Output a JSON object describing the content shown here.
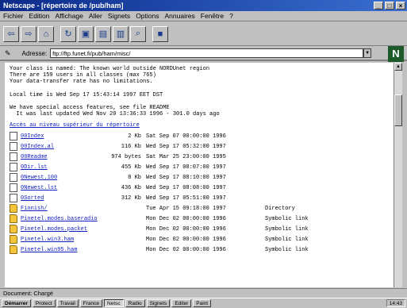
{
  "window": {
    "title": "Netscape - [répertoire de /pub/ham]"
  },
  "menu": [
    "Fichier",
    "Edition",
    "Affichage",
    "Aller",
    "Signets",
    "Options",
    "Annuaires",
    "Fenêtre",
    "?"
  ],
  "toolbar": {
    "buttons": [
      "back-icon",
      "forward-icon",
      "home-icon",
      "reload-icon",
      "images-icon",
      "open-icon",
      "print-icon",
      "find-icon",
      "stop-icon"
    ]
  },
  "address": {
    "label": "Adresse:",
    "url": "ftp://ftp.funet.fi/pub/ham/misc/"
  },
  "messages": [
    "Your class is named: The known world outside NORDUnet region",
    "There are 159 users in all classes (max 765)",
    "Your data-transfer rate has no limitations.",
    "",
    "Local time is Wed Sep 17 15:43:14 1997 EET DST",
    "",
    "We have special access features, see file README",
    "  It was last updated Wed Nov 20 13:36:33 1996 - 301.0 days ago"
  ],
  "parent_link": "Accès au niveau supérieur du répertoire",
  "files": [
    {
      "icon": "file",
      "name": "00Index",
      "size": "2 Kb",
      "date": "Sat Sep 07 00:00:00 1996",
      "type": ""
    },
    {
      "icon": "file",
      "name": "00Index.al",
      "size": "116 Kb",
      "date": "Wed Sep 17 05:32:00 1997",
      "type": ""
    },
    {
      "icon": "file",
      "name": "00Readme",
      "size": "974 bytes",
      "date": "Sat Mar 25 23:00:00 1995",
      "type": ""
    },
    {
      "icon": "file",
      "name": "0Dir.lst",
      "size": "455 Kb",
      "date": "Wed Sep 17 08:07:00 1997",
      "type": ""
    },
    {
      "icon": "file",
      "name": "0Newest.100",
      "size": "8 Kb",
      "date": "Wed Sep 17 08:10:00 1997",
      "type": ""
    },
    {
      "icon": "file",
      "name": "0Newest.lst",
      "size": "436 Kb",
      "date": "Wed Sep 17 08:08:00 1997",
      "type": ""
    },
    {
      "icon": "file",
      "name": "0Sorted",
      "size": "312 Kb",
      "date": "Wed Sep 17 05:51:00 1997",
      "type": ""
    },
    {
      "icon": "folder",
      "name": "Finnish/",
      "size": "",
      "date": "Tue Apr 15 09:18:00 1997",
      "type": "Directory"
    },
    {
      "icon": "folder",
      "name": "Pinetel.modes.baseradio",
      "size": "",
      "date": "Mon Dec 02 00:00:00 1996",
      "type": "Symbolic link"
    },
    {
      "icon": "folder",
      "name": "Pinetel.modes.packet",
      "size": "",
      "date": "Mon Dec 02 00:00:00 1996",
      "type": "Symbolic link"
    },
    {
      "icon": "folder",
      "name": "Pinetel.win3.ham",
      "size": "",
      "date": "Mon Dec 02 00:00:00 1996",
      "type": "Symbolic link"
    },
    {
      "icon": "folder",
      "name": "Pinetel.win95.ham",
      "size": "",
      "date": "Mon Dec 02 00:00:00 1996",
      "type": "Symbolic link"
    }
  ],
  "status": {
    "text": "Document: Chargé"
  },
  "taskbar": {
    "items": [
      "Démarrer",
      "Protect",
      "Travail",
      "France",
      "Netsc",
      "Radio",
      "Signets",
      "Editer",
      "Paint"
    ],
    "active_index": 4,
    "clock": "14:43"
  }
}
